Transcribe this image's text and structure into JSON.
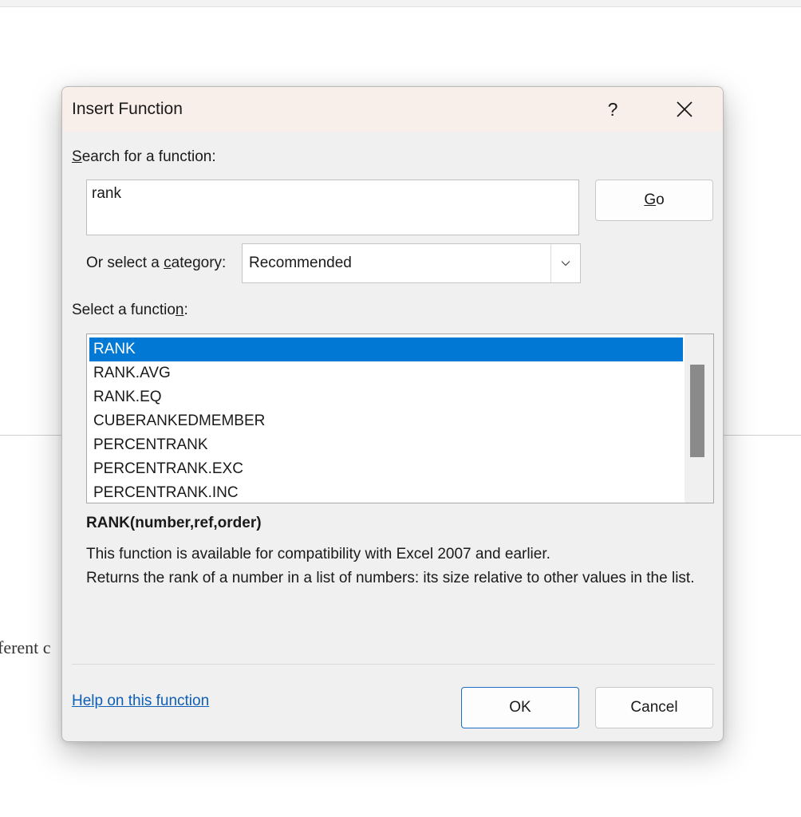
{
  "background": {
    "partial_text": "ferent c"
  },
  "dialog": {
    "title": "Insert Function",
    "help_label": "?",
    "close_icon": "close-icon",
    "search_label_first": "S",
    "search_label_rest": "earch for a function:",
    "search_value": "rank",
    "go_first": "G",
    "go_rest": "o",
    "category_prefix": "Or select a ",
    "category_accel": "c",
    "category_suffix": "ategory:",
    "category_value": "Recommended",
    "function_label_prefix": "Select a functio",
    "function_label_accel": "n",
    "function_label_suffix": ":",
    "functions": [
      "RANK",
      "RANK.AVG",
      "RANK.EQ",
      "CUBERANKEDMEMBER",
      "PERCENTRANK",
      "PERCENTRANK.EXC",
      "PERCENTRANK.INC"
    ],
    "selected_function": "RANK",
    "signature": "RANK(number,ref,order)",
    "description_line1": "This function is available for compatibility with Excel 2007 and earlier.",
    "description_line2": "Returns the rank of a number in a list of numbers: its size relative to other values in the list.",
    "help_link": "Help on this function",
    "ok_label": "OK",
    "cancel_label": "Cancel"
  },
  "colors": {
    "accent": "#0078d4",
    "titlebar": "#f9efea",
    "dialog_bg": "#f0f0f0",
    "link": "#0e5fb5"
  }
}
